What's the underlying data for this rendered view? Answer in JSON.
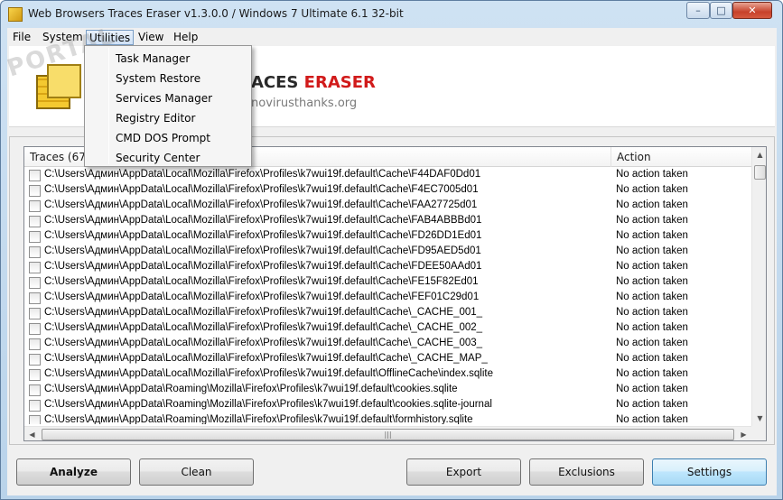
{
  "window": {
    "title": "Web Browsers Traces Eraser v1.3.0.0 / Windows 7 Ultimate 6.1 32-bit",
    "min_label": "–",
    "max_label": "□",
    "close_label": "✕"
  },
  "menu": {
    "file": "File",
    "system": "System",
    "utilities": "Utilities",
    "view": "View",
    "help": "Help"
  },
  "utilities_menu": [
    "Task Manager",
    "System Restore",
    "Services Manager",
    "Registry Editor",
    "CMD DOS Prompt",
    "Security Center"
  ],
  "header": {
    "brand_visible": "ACES ",
    "brand_red": "ERASER",
    "url_visible": "novirusthanks.org"
  },
  "watermark": "PORTAL",
  "list": {
    "col_traces": "Traces (6724",
    "col_action": "Action",
    "rows": [
      {
        "path": "C:\\Users\\Админ\\AppData\\Local\\Mozilla\\Firefox\\Profiles\\k7wui19f.default\\Cache\\F44DAF0Dd01",
        "action": "No action taken"
      },
      {
        "path": "C:\\Users\\Админ\\AppData\\Local\\Mozilla\\Firefox\\Profiles\\k7wui19f.default\\Cache\\F4EC7005d01",
        "action": "No action taken"
      },
      {
        "path": "C:\\Users\\Админ\\AppData\\Local\\Mozilla\\Firefox\\Profiles\\k7wui19f.default\\Cache\\FAA27725d01",
        "action": "No action taken"
      },
      {
        "path": "C:\\Users\\Админ\\AppData\\Local\\Mozilla\\Firefox\\Profiles\\k7wui19f.default\\Cache\\FAB4ABBBd01",
        "action": "No action taken"
      },
      {
        "path": "C:\\Users\\Админ\\AppData\\Local\\Mozilla\\Firefox\\Profiles\\k7wui19f.default\\Cache\\FD26DD1Ed01",
        "action": "No action taken"
      },
      {
        "path": "C:\\Users\\Админ\\AppData\\Local\\Mozilla\\Firefox\\Profiles\\k7wui19f.default\\Cache\\FD95AED5d01",
        "action": "No action taken"
      },
      {
        "path": "C:\\Users\\Админ\\AppData\\Local\\Mozilla\\Firefox\\Profiles\\k7wui19f.default\\Cache\\FDEE50AAd01",
        "action": "No action taken"
      },
      {
        "path": "C:\\Users\\Админ\\AppData\\Local\\Mozilla\\Firefox\\Profiles\\k7wui19f.default\\Cache\\FE15F82Ed01",
        "action": "No action taken"
      },
      {
        "path": "C:\\Users\\Админ\\AppData\\Local\\Mozilla\\Firefox\\Profiles\\k7wui19f.default\\Cache\\FEF01C29d01",
        "action": "No action taken"
      },
      {
        "path": "C:\\Users\\Админ\\AppData\\Local\\Mozilla\\Firefox\\Profiles\\k7wui19f.default\\Cache\\_CACHE_001_",
        "action": "No action taken"
      },
      {
        "path": "C:\\Users\\Админ\\AppData\\Local\\Mozilla\\Firefox\\Profiles\\k7wui19f.default\\Cache\\_CACHE_002_",
        "action": "No action taken"
      },
      {
        "path": "C:\\Users\\Админ\\AppData\\Local\\Mozilla\\Firefox\\Profiles\\k7wui19f.default\\Cache\\_CACHE_003_",
        "action": "No action taken"
      },
      {
        "path": "C:\\Users\\Админ\\AppData\\Local\\Mozilla\\Firefox\\Profiles\\k7wui19f.default\\Cache\\_CACHE_MAP_",
        "action": "No action taken"
      },
      {
        "path": "C:\\Users\\Админ\\AppData\\Local\\Mozilla\\Firefox\\Profiles\\k7wui19f.default\\OfflineCache\\index.sqlite",
        "action": "No action taken"
      },
      {
        "path": "C:\\Users\\Админ\\AppData\\Roaming\\Mozilla\\Firefox\\Profiles\\k7wui19f.default\\cookies.sqlite",
        "action": "No action taken"
      },
      {
        "path": "C:\\Users\\Админ\\AppData\\Roaming\\Mozilla\\Firefox\\Profiles\\k7wui19f.default\\cookies.sqlite-journal",
        "action": "No action taken"
      },
      {
        "path": "C:\\Users\\Админ\\AppData\\Roaming\\Mozilla\\Firefox\\Profiles\\k7wui19f.default\\formhistory.sqlite",
        "action": "No action taken"
      }
    ]
  },
  "buttons": {
    "analyze": "Analyze",
    "clean": "Clean",
    "export": "Export",
    "exclusions": "Exclusions",
    "settings": "Settings"
  }
}
